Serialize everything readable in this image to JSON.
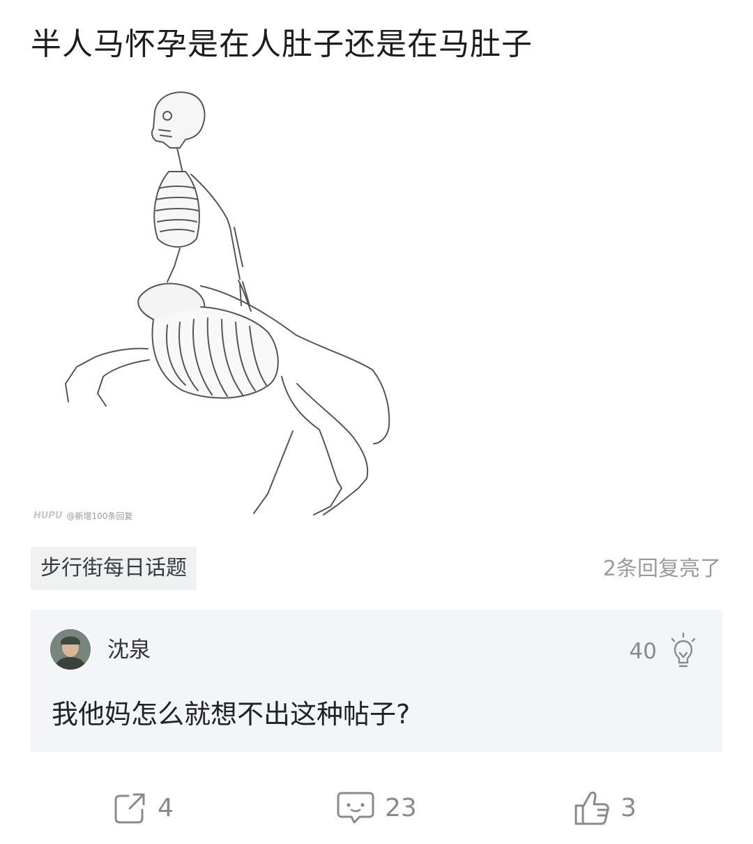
{
  "post": {
    "title": "半人马怀孕是在人肚子还是在马肚子",
    "image": {
      "watermark_logo": "HUPU",
      "watermark_text": "@新增100条回复"
    },
    "topic_tag": "步行街每日话题",
    "replies_lit": "2条回复亮了"
  },
  "comment": {
    "username": "沈泉",
    "like_count": "40",
    "text": "我他妈怎么就想不出这种帖子?",
    "icons": {
      "avatar": "user-avatar",
      "like": "lightbulb-icon"
    }
  },
  "actions": {
    "share": {
      "count": "4",
      "icon": "share-icon"
    },
    "comment": {
      "count": "23",
      "icon": "comment-icon"
    },
    "like": {
      "count": "3",
      "icon": "thumbs-up-icon"
    }
  },
  "colors": {
    "background": "#ffffff",
    "comment_bg": "#f3f5f8",
    "tag_bg": "#f0f1f3",
    "muted_text": "#8a8a8a"
  }
}
